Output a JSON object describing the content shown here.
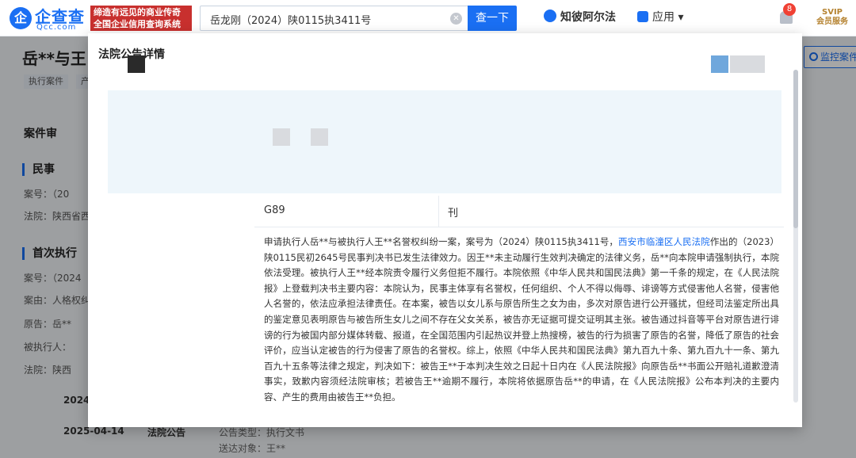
{
  "header": {
    "logo_mark": "企",
    "logo_text": "企查查",
    "logo_sub": "Qcc.com",
    "slogan_line1": "缔造有远见的商业传奇",
    "slogan_line2": "全国企业信用查询系统",
    "search_value": "岳龙刚（2024）陕0115执3411号",
    "search_button": "查一下",
    "zhibo_label": "知彼阿尔法",
    "app_label": "应用",
    "notification_count": "8",
    "svip_line1": "SVIP",
    "svip_line2": "会员服务"
  },
  "page": {
    "case_title": "岳**与王",
    "tag1": "执行案件",
    "tag2": "产",
    "monitor_button": "监控案件",
    "case_heading": "案件审",
    "section_civil": "民事",
    "civil_case_no": "案号：（20",
    "civil_court": "法院：陕西省西",
    "section_first": "首次执行",
    "first_case_no": "案号：（2024",
    "first_cause": "案由：人格权纠",
    "first_plaintiff": "原告：岳**",
    "first_defendant": "被执行人：",
    "first_court": "法院：陕西",
    "timeline_year": "2024",
    "timeline_date": "2025-04-14",
    "timeline_type": "法院公告",
    "announcement_type": "公告类型：执行文书",
    "delivery_target": "送达对象：王**"
  },
  "modal": {
    "title": "法院公告详情",
    "g89": "G89",
    "xing": "刊",
    "text_part1": "申请执行人岳**与被执行人王**名誉权纠纷一案，案号为（2024）陕0115执3411号，",
    "court_link": "西安市临潼区人民法院",
    "text_part2": "作出的（2023）陕0115民初2645号民事判决书已发生法律效力。因王**未主动履行生效判决确定的法律义务，岳**向本院申请强制执行，本院依法受理。被执行人王**经本院责令履行义务但拒不履行。本院依照《中华人民共和国民法典》第一千条的规定，在《人民法院报》上登载判决书主要内容：本院认为，民事主体享有名誉权，任何组织、个人不得以侮辱、诽谤等方式侵害他人名誉，侵害他人名誉的，依法应承担法律责任。在本案，被告以女儿系与原告所生之女为由，多次对原告进行公开骚扰，但经司法鉴定所出具的鉴定意见表明原告与被告所生女儿之间不存在父女关系，被告亦无证据可提交证明其主张。被告通过抖音等平台对原告进行诽谤的行为被国内部分媒体转载、报道，在全国范围内引起热议并登上热搜榜，被告的行为损害了原告的名誉，降低了原告的社会评价，应当认定被告的行为侵害了原告的名誉权。综上，依照《中华人民共和国民法典》第九百九十条、第九百九十一条、第九百九十五条等法律之规定，判决如下：被告王**于本判决生效之日起十日内在《人民法院报》向原告岳**书面公开赔礼道歉澄清事实，致歉内容须经法院审核；若被告王**逾期不履行，本院将依据原告岳**的申请，在《人民法院报》公布本判决的主要内容、产生的费用由被告王**负担。"
  },
  "colors": {
    "brand_blue": "#1a6ff3",
    "slogan_red": "#c8302e",
    "badge_red": "#f04134"
  }
}
